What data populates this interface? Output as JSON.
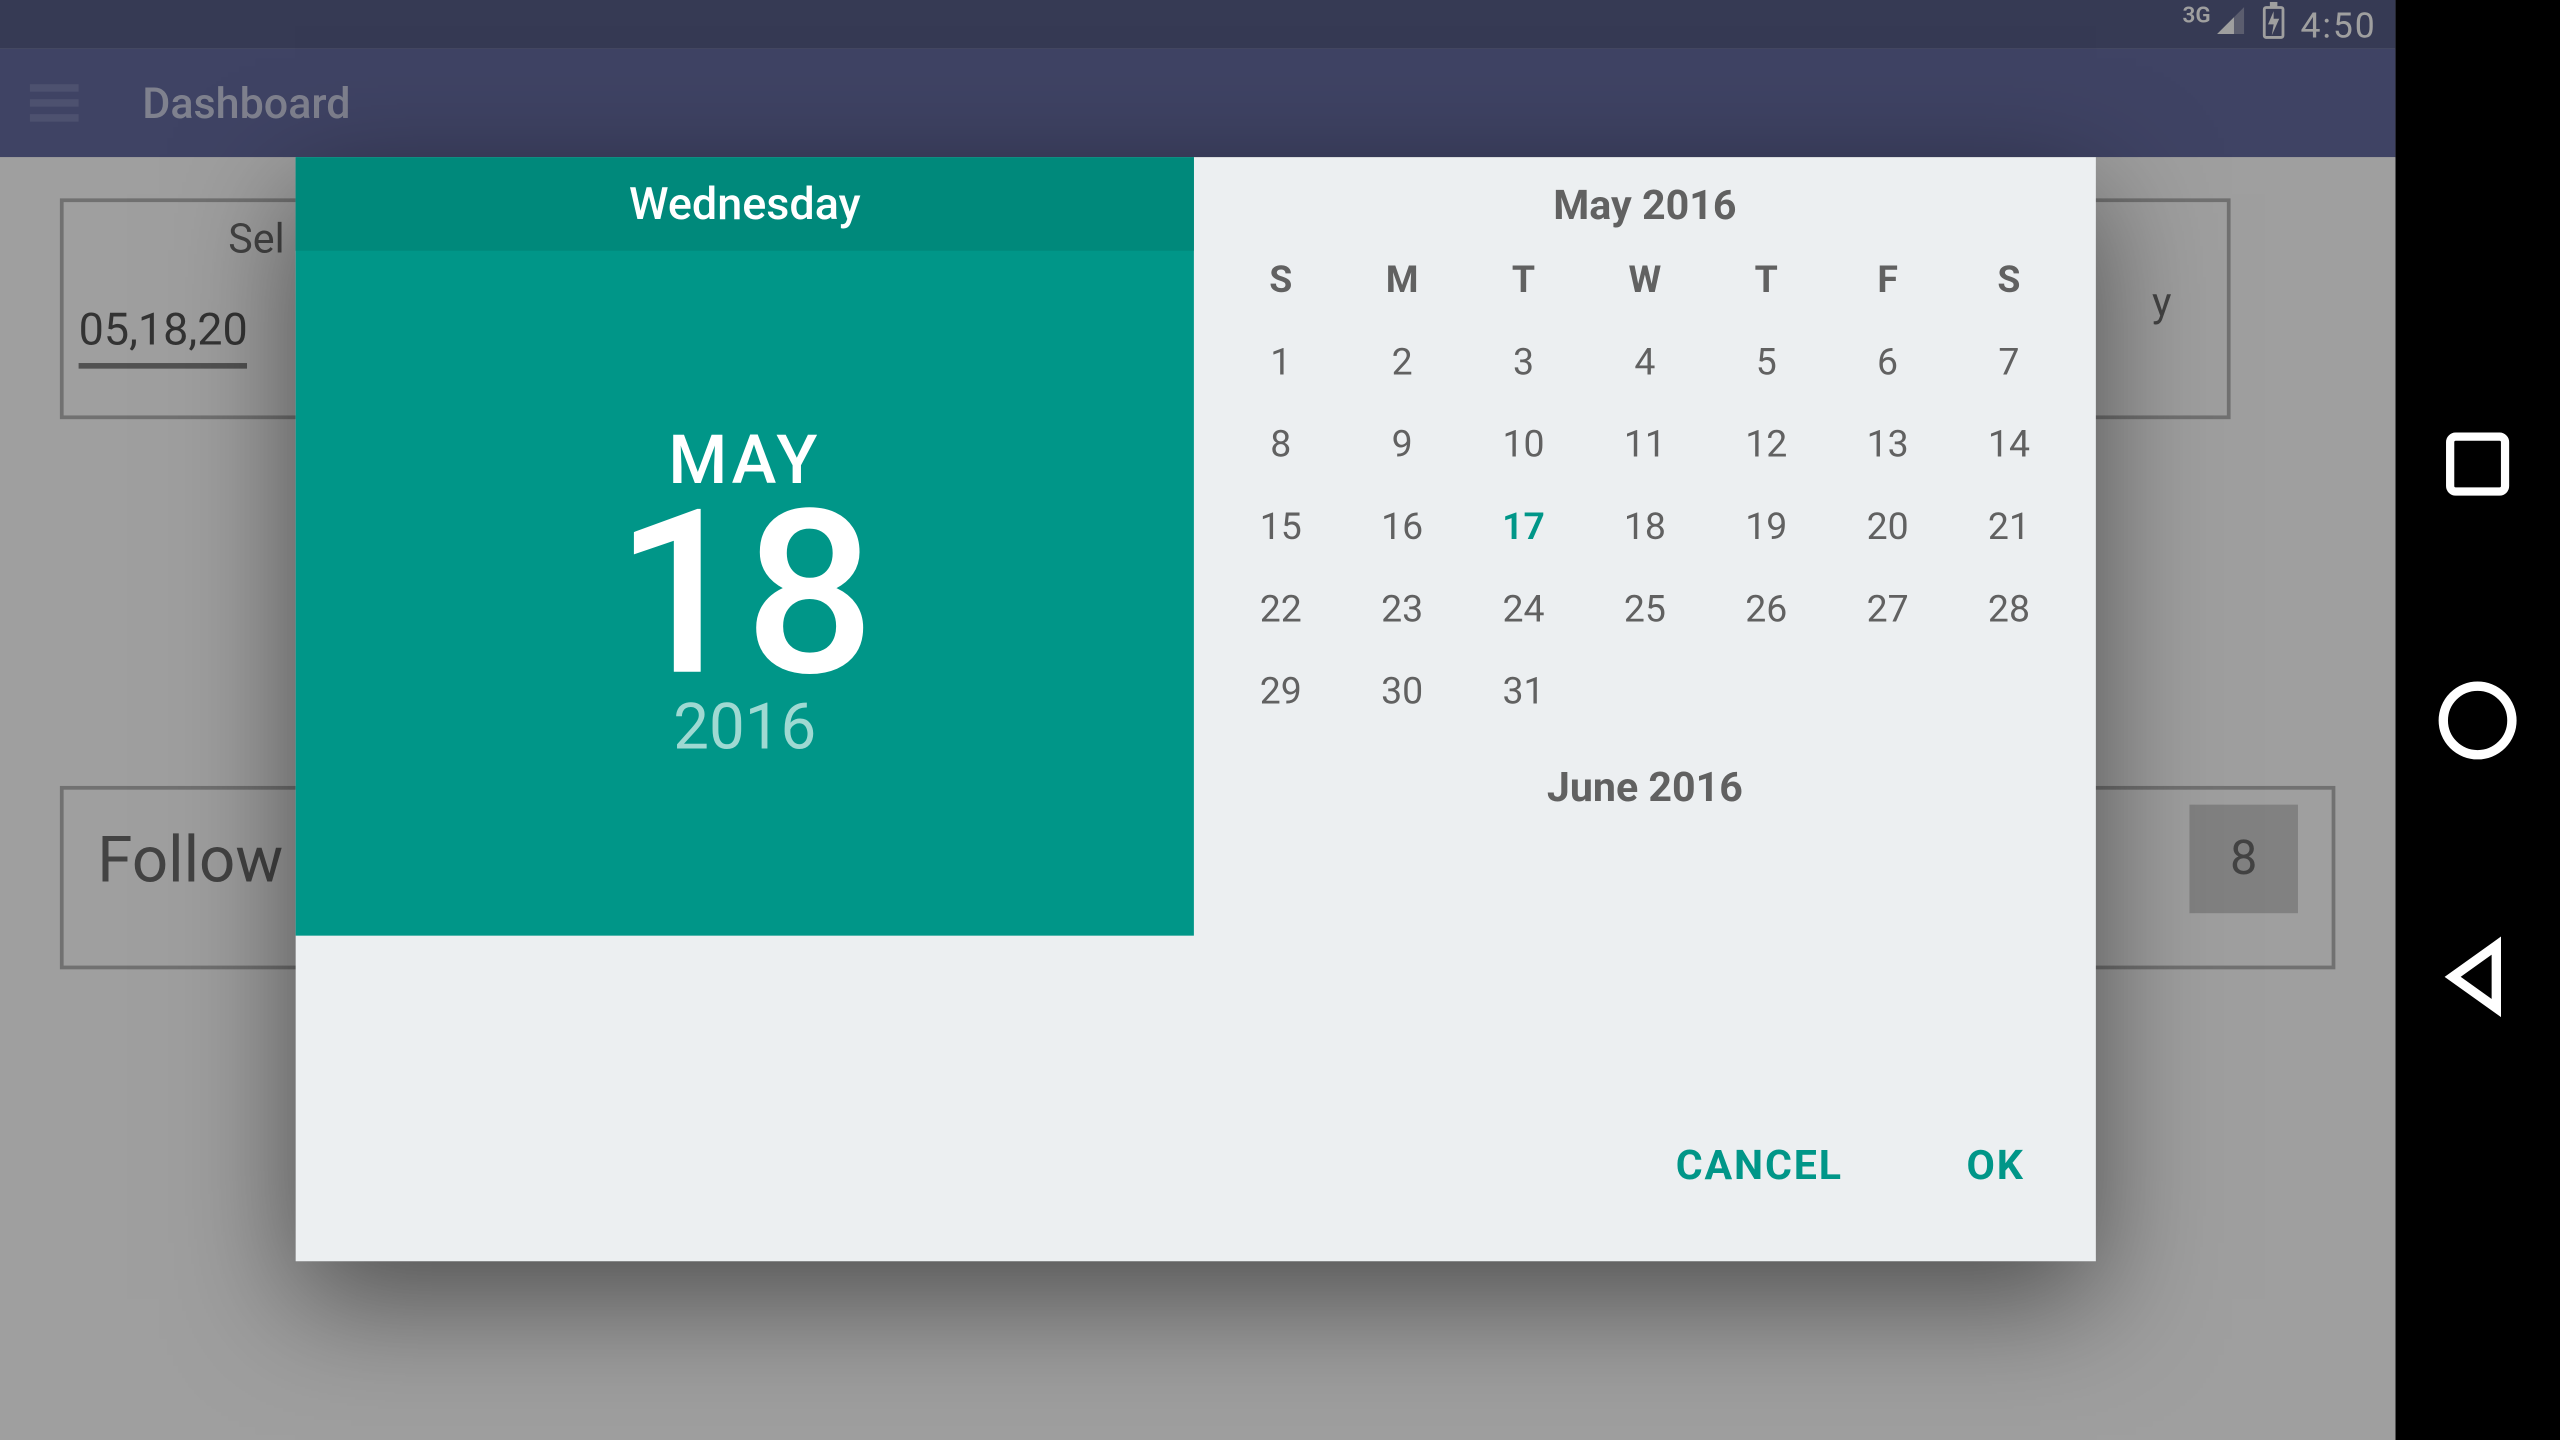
{
  "status": {
    "network": "3G",
    "time": "4:50"
  },
  "appbar": {
    "title": "Dashboard"
  },
  "background": {
    "select_label": "Sel",
    "date_value": "05,18,20",
    "followup_label": "Follow",
    "right_char": "y",
    "count": "8"
  },
  "datepicker": {
    "dayname": "Wednesday",
    "month_abbrev": "MAY",
    "day": "18",
    "year": "2016",
    "month_title": "May 2016",
    "next_month_title": "June 2016",
    "weekdays": [
      "S",
      "M",
      "T",
      "W",
      "T",
      "F",
      "S"
    ],
    "weeks": [
      [
        "1",
        "2",
        "3",
        "4",
        "5",
        "6",
        "7"
      ],
      [
        "8",
        "9",
        "10",
        "11",
        "12",
        "13",
        "14"
      ],
      [
        "15",
        "16",
        "17",
        "18",
        "19",
        "20",
        "21"
      ],
      [
        "22",
        "23",
        "24",
        "25",
        "26",
        "27",
        "28"
      ],
      [
        "29",
        "30",
        "31",
        "",
        "",
        "",
        ""
      ]
    ],
    "today_day": "17",
    "selected_day": "18",
    "actions": {
      "cancel": "CANCEL",
      "ok": "OK"
    }
  }
}
